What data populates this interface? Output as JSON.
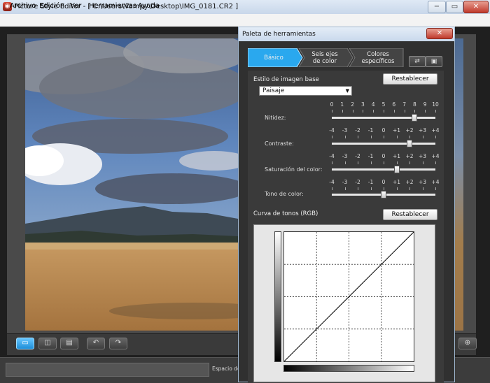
{
  "window": {
    "title": "Picture Style Editor - [ C:\\Users\\Vampy\\Desktop\\IMG_0181.CR2 ]",
    "app_icon": "picture-style-editor-icon",
    "minimize_icon": "minimize-icon",
    "maximize_icon": "maximize-icon",
    "close_icon": "close-icon"
  },
  "menu": {
    "items": [
      "Archivo",
      "Edición",
      "Ver",
      "Herramientas",
      "Ayuda"
    ]
  },
  "toolbar": {
    "buttons": [
      {
        "icon": "single-view-icon",
        "active": true
      },
      {
        "icon": "split-view-icon",
        "active": false
      },
      {
        "icon": "fit-view-icon",
        "active": false
      },
      {
        "icon": "rotate-left-icon",
        "active": false
      },
      {
        "icon": "rotate-right-icon",
        "active": false
      },
      {
        "icon": "zoom-icon",
        "active": false
      }
    ]
  },
  "status": {
    "label": "Espacio de c"
  },
  "palette": {
    "title": "Paleta de herramientas",
    "close_icon": "close-icon",
    "tabs": [
      "Básico",
      "Seis ejes\nde color",
      "Colores\nespecíficos"
    ],
    "active_tab": 0,
    "tab_buttons": [
      "save-preset-icon",
      "save-file-icon"
    ],
    "base_style": {
      "label": "Estilo de imagen base",
      "reset": "Restablecer",
      "selected": "Paisaje"
    },
    "sliders": [
      {
        "label": "Nitidez:",
        "scale": [
          "0",
          "1",
          "2",
          "3",
          "4",
          "5",
          "6",
          "7",
          "8",
          "9",
          "10"
        ],
        "value_fraction": 0.8
      },
      {
        "label": "Contraste:",
        "scale": [
          "-4",
          "-3",
          "-2",
          "-1",
          "0",
          "+1",
          "+2",
          "+3",
          "+4"
        ],
        "value_fraction": 0.75
      },
      {
        "label": "Saturación del color:",
        "scale": [
          "-4",
          "-3",
          "-2",
          "-1",
          "0",
          "+1",
          "+2",
          "+3",
          "+4"
        ],
        "value_fraction": 0.625
      },
      {
        "label": "Tono de color:",
        "scale": [
          "-4",
          "-3",
          "-2",
          "-1",
          "0",
          "+1",
          "+2",
          "+3",
          "+4"
        ],
        "value_fraction": 0.5
      }
    ],
    "curve": {
      "label": "Curva de tonos (RGB)",
      "reset": "Restablecer"
    }
  },
  "colors": {
    "active_tab": "#2aa8ee",
    "palette_border": "#9fb6cf"
  }
}
